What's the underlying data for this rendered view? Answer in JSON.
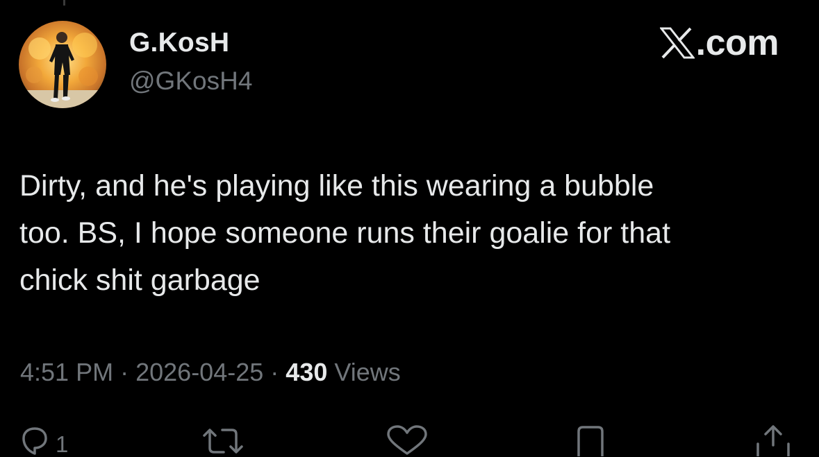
{
  "tweet": {
    "author": {
      "display_name": "G.KosH",
      "handle": "@GKosH4"
    },
    "brand": {
      "text": ".com",
      "icon": "x-logo-icon"
    },
    "text": "Dirty, and he's playing like this wearing a bubble\ntoo. BS, I hope someone runs their goalie for that\nchick shit garbage",
    "meta": {
      "time": "4:51 PM",
      "separator": "·",
      "date": "2026-04-25",
      "views_count": "430",
      "views_label": "Views"
    },
    "actions": {
      "reply": {
        "icon": "reply-icon",
        "count": "1"
      },
      "retweet": {
        "icon": "retweet-icon"
      },
      "like": {
        "icon": "heart-icon"
      },
      "bookmark": {
        "icon": "bookmark-icon"
      },
      "share": {
        "icon": "share-icon"
      }
    }
  },
  "colors": {
    "background": "#000000",
    "primary_text": "#e7e9ea",
    "secondary_text": "#71767b"
  }
}
